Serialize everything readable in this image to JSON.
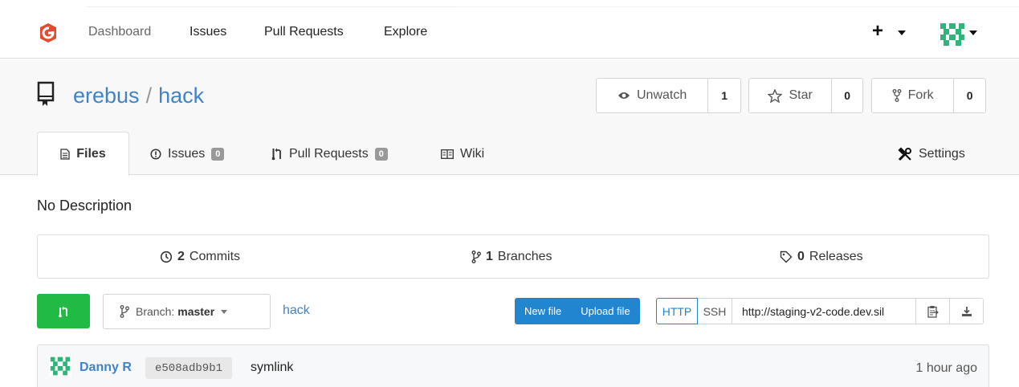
{
  "nav": {
    "dashboard": "Dashboard",
    "issues": "Issues",
    "pull_requests": "Pull Requests",
    "explore": "Explore",
    "plus": "+"
  },
  "repo": {
    "owner": "erebus",
    "separator": "/",
    "name": "hack",
    "watch": {
      "label": "Unwatch",
      "count": "1"
    },
    "star": {
      "label": "Star",
      "count": "0"
    },
    "fork": {
      "label": "Fork",
      "count": "0"
    }
  },
  "tabs": {
    "files": "Files",
    "issues": "Issues",
    "issues_count": "0",
    "pulls": "Pull Requests",
    "pulls_count": "0",
    "wiki": "Wiki",
    "settings": "Settings"
  },
  "description": "No Description",
  "stats": {
    "commits_count": "2",
    "commits_label": "Commits",
    "branches_count": "1",
    "branches_label": "Branches",
    "releases_count": "0",
    "releases_label": "Releases"
  },
  "toolbar": {
    "branch_prefix": "Branch:",
    "branch_name": "master",
    "path": "hack",
    "new_file": "New file",
    "upload_file": "Upload file",
    "http": "HTTP",
    "ssh": "SSH",
    "clone_url": "http://staging-v2-code.dev.sil"
  },
  "commit": {
    "author": "Danny R",
    "sha": "e508adb9b1",
    "message": "symlink",
    "time": "1 hour ago"
  },
  "colors": {
    "accent": "#4183c4",
    "primary_button": "#2185d0",
    "green_button": "#21ba45",
    "logo": "#e5492e"
  }
}
